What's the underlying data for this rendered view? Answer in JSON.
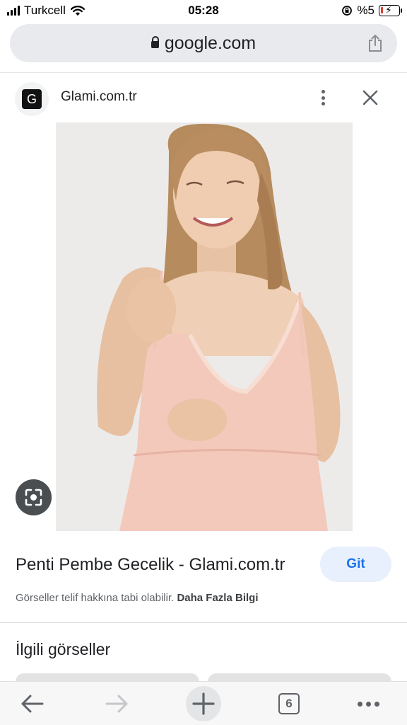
{
  "status_bar": {
    "carrier": "Turkcell",
    "time": "05:28",
    "battery": "%5"
  },
  "url_bar": {
    "domain": "google.com"
  },
  "source": {
    "favicon_letter": "G",
    "site_name": "Glami.com.tr"
  },
  "result": {
    "title": "Penti Pembe Gecelik - Glami.com.tr",
    "go_label": "Git",
    "copyright_text": "Görseller telif hakkına tabi olabilir.",
    "more_info_link": "Daha Fazla Bilgi"
  },
  "related": {
    "heading": "İlgili görseller"
  },
  "toolbar": {
    "tab_count": "6"
  },
  "colors": {
    "accent": "#1a73e8",
    "go_button_bg": "#e8f0fe",
    "url_bar_bg": "#e8eaed",
    "battery_low": "#e53935",
    "nightgown_pink": "#f3c9bb",
    "image_background": "#ece9e7"
  },
  "icons": [
    "signal-icon",
    "wifi-icon",
    "orientation-lock-icon",
    "battery-icon",
    "lock-icon",
    "share-icon",
    "more-vert-icon",
    "close-icon",
    "lens-icon",
    "back-icon",
    "forward-icon",
    "plus-icon",
    "tabs-icon",
    "more-horiz-icon"
  ]
}
